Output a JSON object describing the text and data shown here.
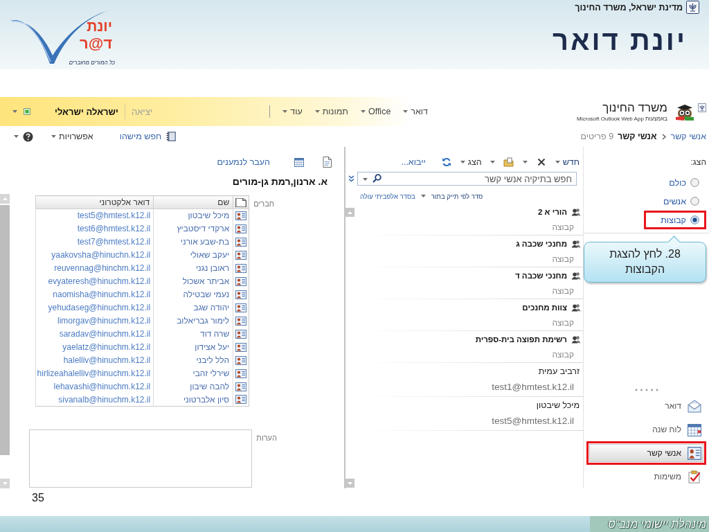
{
  "header": {
    "ministry": "מדינת ישראל, משרד החינוך",
    "title": "יונת דואר",
    "logo": {
      "line_1": "יונת",
      "line_2": "ד@ר",
      "tagline": "כל המורים מחוברים"
    }
  },
  "app_bar": {
    "organization": "משרד החינוך",
    "product": "באמצעות Microsoft Outlook Web App",
    "nav": [
      {
        "label": "דואר"
      },
      {
        "label": "Office"
      },
      {
        "label": "תמונות"
      },
      {
        "label": "עוד"
      }
    ],
    "sign_out": "יציאה",
    "user": "ישראלה ישראלי"
  },
  "sub_bar": {
    "breadcrumb": [
      {
        "label": "אנשי קשר",
        "kind": "link"
      },
      {
        "label": "אנשי קשר",
        "kind": "current"
      }
    ],
    "item_count": "9 פריטים",
    "find_someone": "חפש מישהו",
    "options": "אפשרויות"
  },
  "nav_pane": {
    "show_label": "הצג:",
    "filters": [
      {
        "label": "כולם",
        "selected": false,
        "highlighted": false
      },
      {
        "label": "אנשים",
        "selected": false,
        "highlighted": false
      },
      {
        "label": "קבוצות",
        "selected": true,
        "highlighted": true
      }
    ],
    "callout": "28. לחץ להצגת הקבוצות",
    "modules": [
      {
        "kind": "mail",
        "label": "דואר",
        "selected": false,
        "highlighted": false
      },
      {
        "kind": "calendar",
        "label": "לוח שנה",
        "selected": false,
        "highlighted": false
      },
      {
        "kind": "contacts",
        "label": "אנשי קשר",
        "selected": true,
        "highlighted": true
      },
      {
        "kind": "tasks",
        "label": "משימות",
        "selected": false,
        "highlighted": false
      }
    ]
  },
  "list_pane": {
    "toolbar": {
      "new": "חדש",
      "view": "הצג",
      "import": "ייבוא..."
    },
    "search": {
      "placeholder": "חפש בתיקיה אנשי קשר"
    },
    "sort": {
      "by": "סדר לפי תייק בתור",
      "order": "בסדר אלפביתי עולה"
    },
    "items": [
      {
        "kind": "group",
        "name": "הורי א 2",
        "detail": "קבוצה"
      },
      {
        "kind": "group",
        "name": "מחנכי שכבה ג",
        "detail": "קבוצה"
      },
      {
        "kind": "group",
        "name": "מחנכי שכבה ד",
        "detail": "קבוצה"
      },
      {
        "kind": "group",
        "name": "צוות מחנכים",
        "detail": "קבוצה"
      },
      {
        "kind": "group",
        "name": "רשימת תפוצה בית-ספרית",
        "detail": "קבוצה"
      },
      {
        "kind": "contact",
        "name": "זרביב עמית",
        "detail": "test1@hmtest.k12.il"
      },
      {
        "kind": "contact",
        "name": "מיכל שיבטון",
        "detail": "test5@hmtest.k12.il"
      }
    ]
  },
  "reading_pane": {
    "toolbar": {
      "send_to_recipients": "העבר לנמענים"
    },
    "title": "א. ארנון,רמת גן-מורים",
    "members_label": "חברים",
    "columns": [
      {
        "label": "שם"
      },
      {
        "label": "דואר אלקטרוני"
      }
    ],
    "members": [
      {
        "name": "מיכל שיבטון",
        "email": "test5@hmtest.k12.il"
      },
      {
        "name": "ארקדי דיסטביץ",
        "email": "test6@hmtest.k12.il"
      },
      {
        "name": "בת-שבע אורני",
        "email": "test7@hmtest.k12.il"
      },
      {
        "name": "יעקב שאולי",
        "email": "yaakovsha@hinuchn.k12.il"
      },
      {
        "name": "ראובן נגני",
        "email": "reuvennag@hinchm.k12.il"
      },
      {
        "name": "אביתר אשכול",
        "email": "evyateresh@hinuchm.k12.il"
      },
      {
        "name": "נעמי שבטילה",
        "email": "naomisha@hinuchm.k12.il"
      },
      {
        "name": "יהודה שגב",
        "email": "yehudaseg@hinuchm.k12.il"
      },
      {
        "name": "לימור גבריאלוב",
        "email": "limorgav@hinuchm.k12.il"
      },
      {
        "name": "שרה דוד",
        "email": "saradav@hinuchm.k12.il"
      },
      {
        "name": "יעל אצידון",
        "email": "yaelatz@hinuchm.k12.il"
      },
      {
        "name": "הלל ליבני",
        "email": "halelliv@hinuchm.k12.il"
      },
      {
        "name": "שירלי זהבי",
        "email": "hirlizeahalelliv@hinuchm.k12.il"
      },
      {
        "name": "להבה שיבון",
        "email": "lehavashi@hinuchm.k12.il"
      },
      {
        "name": "סיון אלברטוני",
        "email": "sivanalb@hinuchm.k12.il"
      }
    ],
    "notes_label": "הערות"
  },
  "page_number": "35",
  "footer": {
    "brand": "מינהלת יישומי מנב\"ס"
  }
}
